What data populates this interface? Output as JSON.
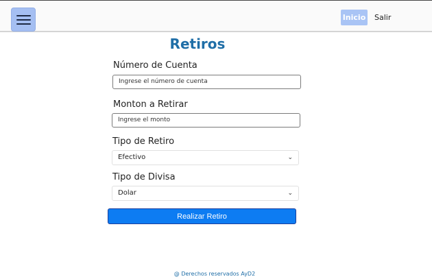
{
  "navbar": {
    "menu_icon": "hamburger-menu-icon",
    "inicio_label": "Inicio",
    "salir_label": "Salir"
  },
  "page": {
    "title": "Retiros"
  },
  "form": {
    "account_label": "Número de Cuenta",
    "account_placeholder": "Ingrese el número de cuenta",
    "amount_label": "Monton a Retirar",
    "amount_placeholder": "Ingrese el monto",
    "withdraw_type_label": "Tipo de Retiro",
    "withdraw_type_value": "Efectivo",
    "currency_label": "Tipo de Divisa",
    "currency_value": "Dolar",
    "submit_label": "Realizar Retiro"
  },
  "footer": {
    "text": "@ Derechos reservados AyD2"
  },
  "colors": {
    "title": "#1f6ea7",
    "primary_button": "#0d7cf2",
    "menu_button": "#a5bff2",
    "nav_active": "#a9c4f5"
  }
}
